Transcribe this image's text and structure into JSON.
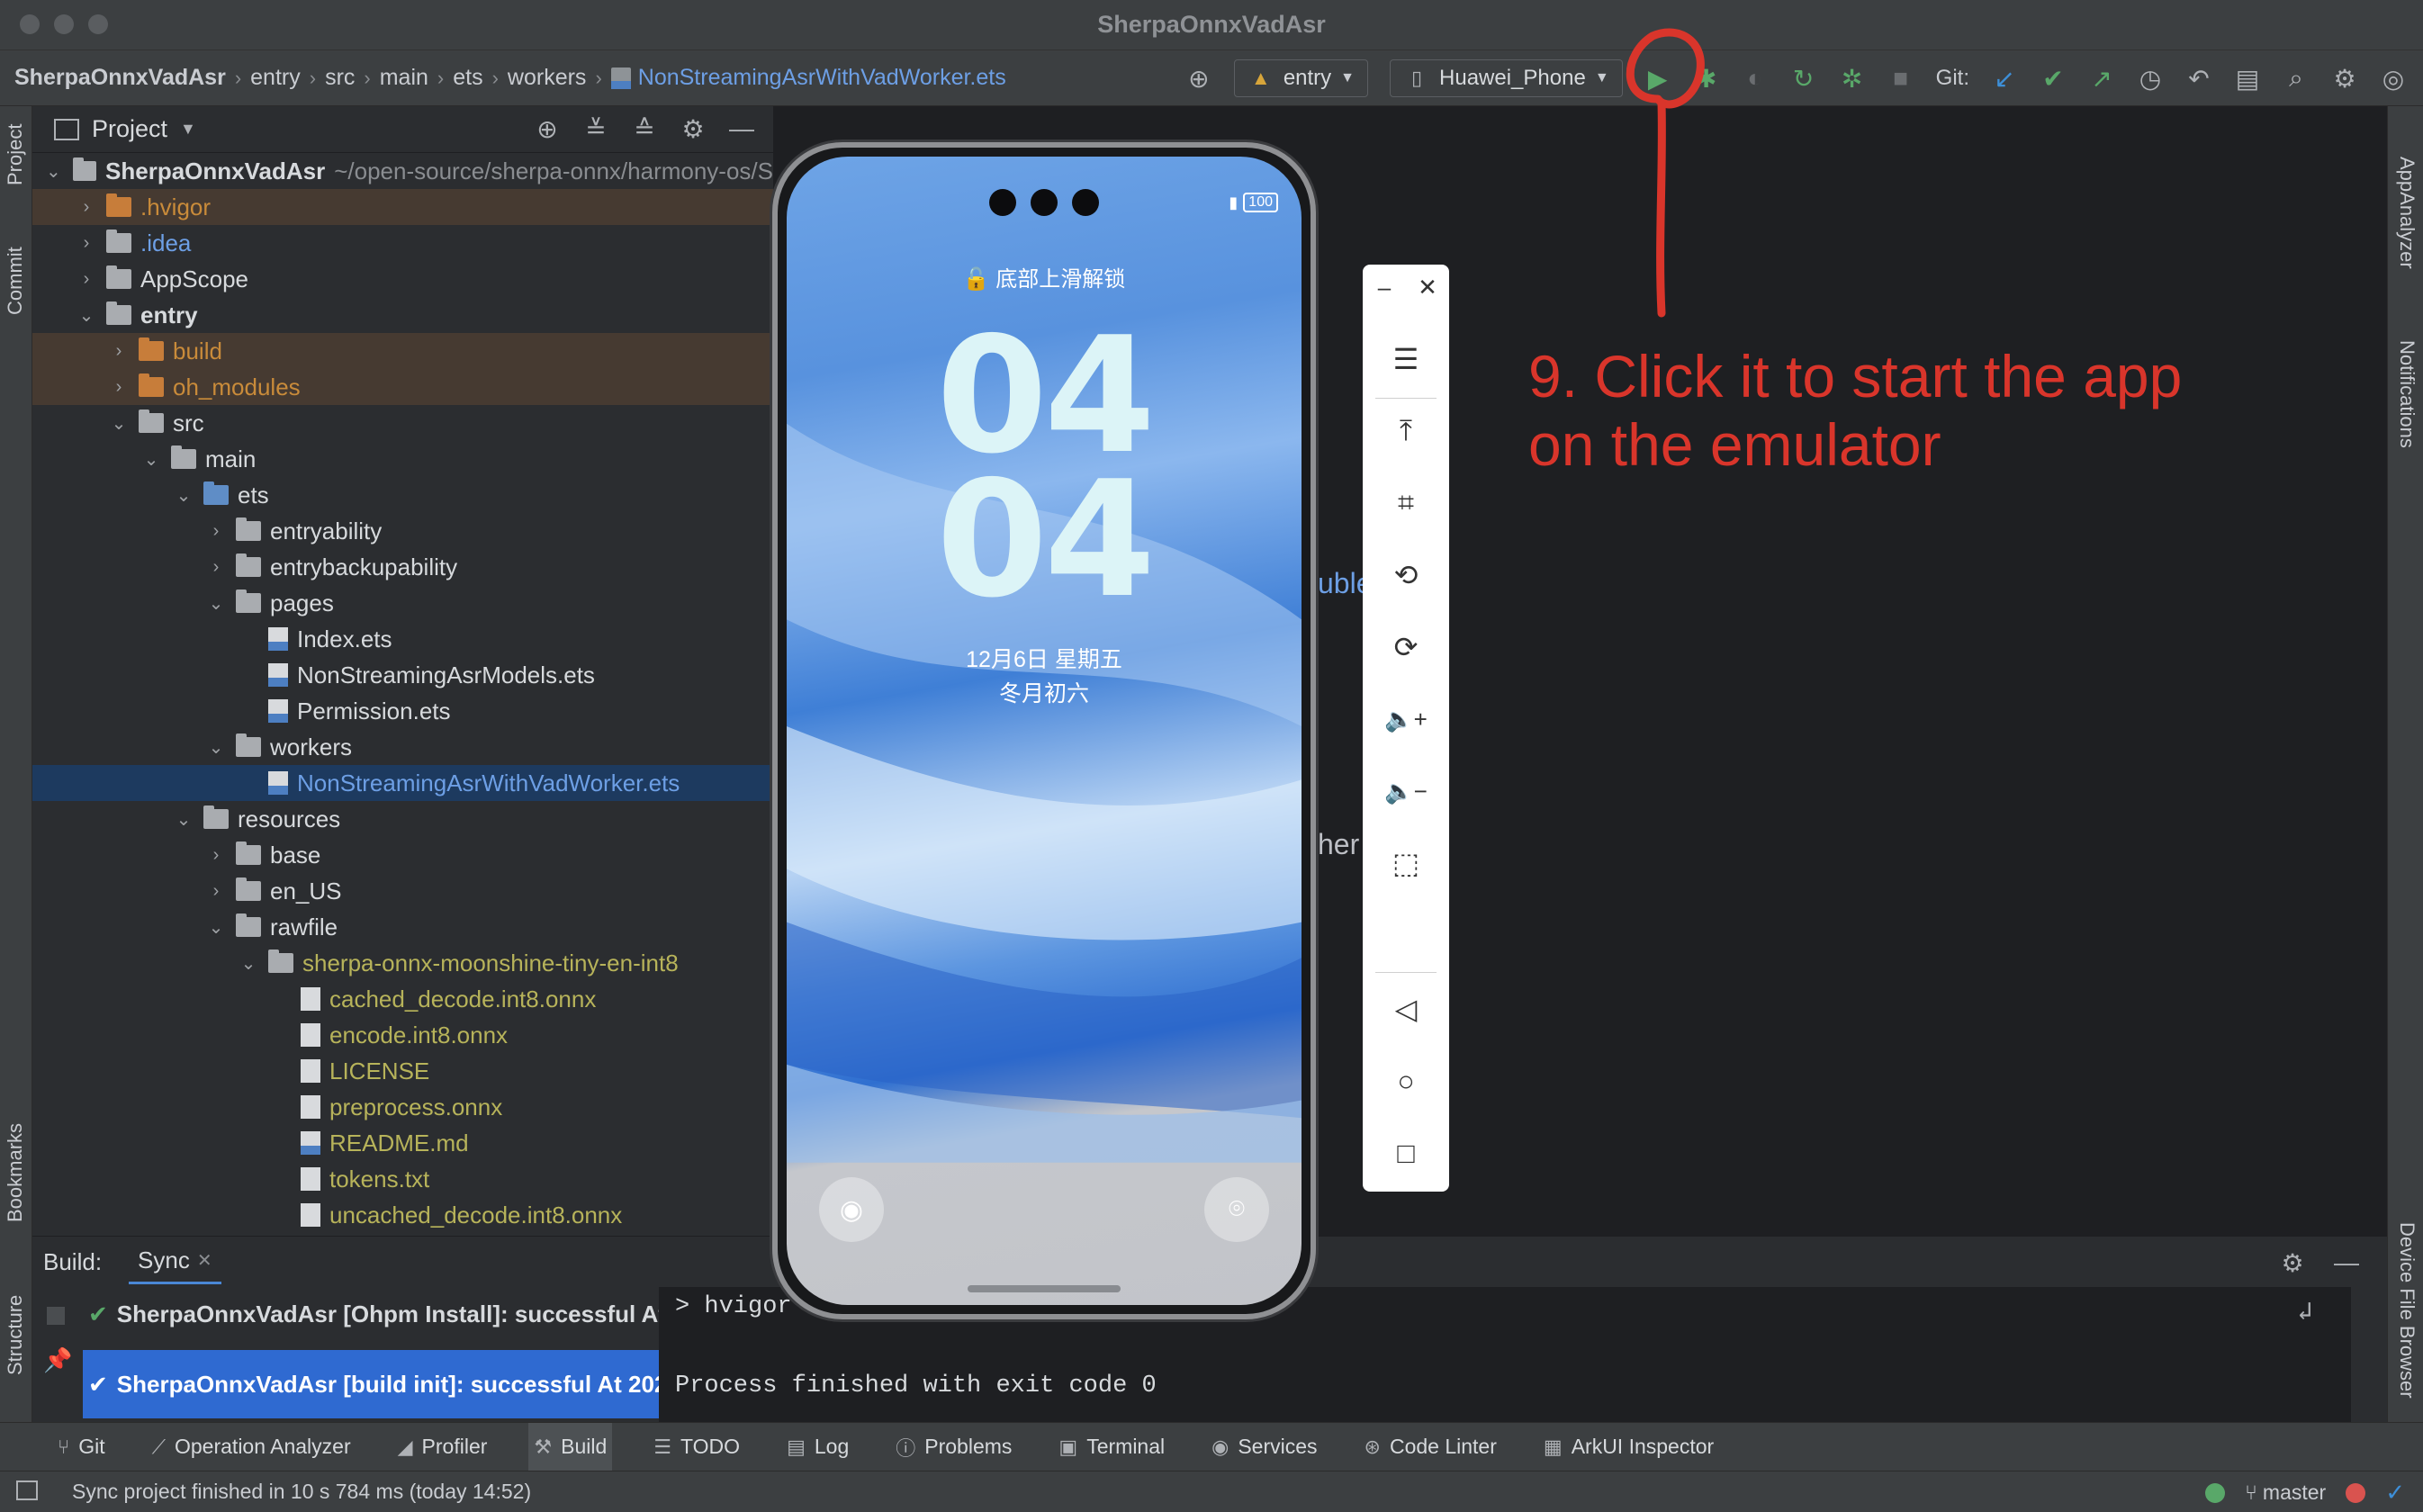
{
  "window": {
    "title": "SherpaOnnxVadAsr"
  },
  "breadcrumb": {
    "items": [
      "SherpaOnnxVadAsr",
      "entry",
      "src",
      "main",
      "ets",
      "workers"
    ],
    "file": "NonStreamingAsrWithVadWorker.ets"
  },
  "toolbar": {
    "module": "entry",
    "device": "Huawei_Phone",
    "git_label": "Git:"
  },
  "left_strip": {
    "project": "Project",
    "commit": "Commit",
    "bookmarks": "Bookmarks",
    "structure": "Structure"
  },
  "right_strip": {
    "app_analyzer": "AppAnalyzer",
    "notifications": "Notifications",
    "device_file_browser": "Device File Browser"
  },
  "project_panel": {
    "title": "Project",
    "root": {
      "name": "SherpaOnnxVadAsr",
      "path": "~/open-source/sherpa-onnx/harmony-os/S"
    },
    "rows": [
      {
        "label": ".hvigor",
        "depth": 1,
        "chev": "›",
        "kind": "folder-orange",
        "style": "excluded"
      },
      {
        "label": ".idea",
        "depth": 1,
        "chev": "›",
        "kind": "folder",
        "style": "blue-text"
      },
      {
        "label": "AppScope",
        "depth": 1,
        "chev": "›",
        "kind": "folder",
        "style": ""
      },
      {
        "label": "entry",
        "depth": 1,
        "chev": "⌄",
        "kind": "folder",
        "style": "bold"
      },
      {
        "label": "build",
        "depth": 2,
        "chev": "›",
        "kind": "folder-orange",
        "style": "excluded"
      },
      {
        "label": "oh_modules",
        "depth": 2,
        "chev": "›",
        "kind": "folder-orange",
        "style": "excluded"
      },
      {
        "label": "src",
        "depth": 2,
        "chev": "⌄",
        "kind": "folder",
        "style": ""
      },
      {
        "label": "main",
        "depth": 3,
        "chev": "⌄",
        "kind": "folder",
        "style": ""
      },
      {
        "label": "ets",
        "depth": 4,
        "chev": "⌄",
        "kind": "folder-blue",
        "style": ""
      },
      {
        "label": "entryability",
        "depth": 5,
        "chev": "›",
        "kind": "folder",
        "style": ""
      },
      {
        "label": "entrybackupability",
        "depth": 5,
        "chev": "›",
        "kind": "folder",
        "style": ""
      },
      {
        "label": "pages",
        "depth": 5,
        "chev": "⌄",
        "kind": "folder",
        "style": ""
      },
      {
        "label": "Index.ets",
        "depth": 6,
        "chev": "",
        "kind": "ets",
        "style": ""
      },
      {
        "label": "NonStreamingAsrModels.ets",
        "depth": 6,
        "chev": "",
        "kind": "ets",
        "style": ""
      },
      {
        "label": "Permission.ets",
        "depth": 6,
        "chev": "",
        "kind": "ets",
        "style": ""
      },
      {
        "label": "workers",
        "depth": 5,
        "chev": "⌄",
        "kind": "folder",
        "style": ""
      },
      {
        "label": "NonStreamingAsrWithVadWorker.ets",
        "depth": 6,
        "chev": "",
        "kind": "ets",
        "style": "selected"
      },
      {
        "label": "resources",
        "depth": 4,
        "chev": "⌄",
        "kind": "folder",
        "style": ""
      },
      {
        "label": "base",
        "depth": 5,
        "chev": "›",
        "kind": "folder",
        "style": ""
      },
      {
        "label": "en_US",
        "depth": 5,
        "chev": "›",
        "kind": "folder",
        "style": ""
      },
      {
        "label": "rawfile",
        "depth": 5,
        "chev": "⌄",
        "kind": "folder",
        "style": ""
      },
      {
        "label": "sherpa-onnx-moonshine-tiny-en-int8",
        "depth": 6,
        "chev": "⌄",
        "kind": "folder",
        "style": "res"
      },
      {
        "label": "cached_decode.int8.onnx",
        "depth": 7,
        "chev": "",
        "kind": "doc",
        "style": "res"
      },
      {
        "label": "encode.int8.onnx",
        "depth": 7,
        "chev": "",
        "kind": "doc",
        "style": "res"
      },
      {
        "label": "LICENSE",
        "depth": 7,
        "chev": "",
        "kind": "doc",
        "style": "res"
      },
      {
        "label": "preprocess.onnx",
        "depth": 7,
        "chev": "",
        "kind": "doc",
        "style": "res"
      },
      {
        "label": "README.md",
        "depth": 7,
        "chev": "",
        "kind": "md",
        "style": "res"
      },
      {
        "label": "tokens.txt",
        "depth": 7,
        "chev": "",
        "kind": "doc",
        "style": "res"
      },
      {
        "label": "uncached_decode.int8.onnx",
        "depth": 7,
        "chev": "",
        "kind": "doc",
        "style": "res"
      }
    ]
  },
  "editor": {
    "fragment_1": "uble",
    "fragment_2": "her"
  },
  "phone": {
    "battery": "100",
    "unlock_text": "底部上滑解锁",
    "hour": "04",
    "minute": "04",
    "date_line": "12月6日  星期五",
    "lunar_line": "冬月初六"
  },
  "emulator_controls": {
    "minimize": "–",
    "close": "✕",
    "menu": "☰",
    "top": "⤒",
    "crop": "⌗",
    "rotate_left": "⟲",
    "rotate_right": "⟳",
    "vol_up": "🔈+",
    "vol_down": "🔈−",
    "shake": "⬚",
    "back": "◁",
    "home": "○",
    "recent": "□"
  },
  "annotation": {
    "line_1": "9. Click it to start the app",
    "line_2": "on the emulator",
    "color": "#d9352b"
  },
  "build_panel": {
    "label": "Build:",
    "tab": "Sync",
    "items": [
      {
        "text": "SherpaOnnxVadAsr [Ohpm Install]: successful At",
        "bold": "SherpaOnnxVadAsr [Ohpm Install]:"
      },
      {
        "text": "SherpaOnnxVadAsr [build init]: successful At 202",
        "bold": "SherpaOnnxVadAsr [build init]:"
      }
    ],
    "console": [
      "> hvigor",
      "",
      "Process finished with exit code 0"
    ]
  },
  "bottom_tabs": [
    "Git",
    "Operation Analyzer",
    "Profiler",
    "Build",
    "TODO",
    "Log",
    "Problems",
    "Terminal",
    "Services",
    "Code Linter",
    "ArkUI Inspector"
  ],
  "bottom_tabs_active": "Build",
  "status": {
    "message": "Sync project finished in 10 s 784 ms (today 14:52)",
    "branch": "master"
  }
}
